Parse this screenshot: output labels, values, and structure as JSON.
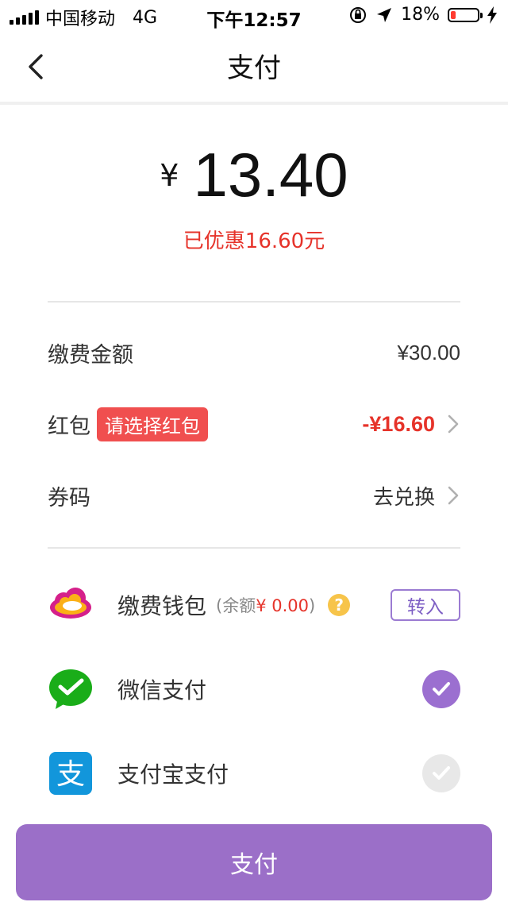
{
  "status_bar": {
    "carrier": "中国移动",
    "network": "4G",
    "time": "下午12:57",
    "battery_percent": "18%",
    "battery_level": 0.18
  },
  "nav": {
    "title": "支付"
  },
  "amount": {
    "currency": "¥",
    "value": "13.40",
    "discount_text": "已优惠16.60元"
  },
  "details": {
    "fee_label": "缴费金额",
    "fee_value": "¥30.00",
    "red_packet_label": "红包",
    "red_packet_badge": "请选择红包",
    "red_packet_value": "-¥16.60",
    "coupon_label": "券码",
    "coupon_value": "去兑换"
  },
  "payment_methods": {
    "wallet": {
      "label": "缴费钱包",
      "balance_prefix": "(余额",
      "balance_value": "¥ 0.00",
      "balance_suffix": ")",
      "help": "?",
      "transfer_button": "转入"
    },
    "wechat": {
      "label": "微信支付",
      "selected": true
    },
    "alipay": {
      "label": "支付宝支付",
      "selected": false,
      "icon_glyph": "支"
    }
  },
  "pay_button": {
    "label": "支付"
  },
  "colors": {
    "accent": "#9b6fc8",
    "red": "#e6332a",
    "wechat_green": "#1aad19",
    "alipay_blue": "#1296db"
  }
}
